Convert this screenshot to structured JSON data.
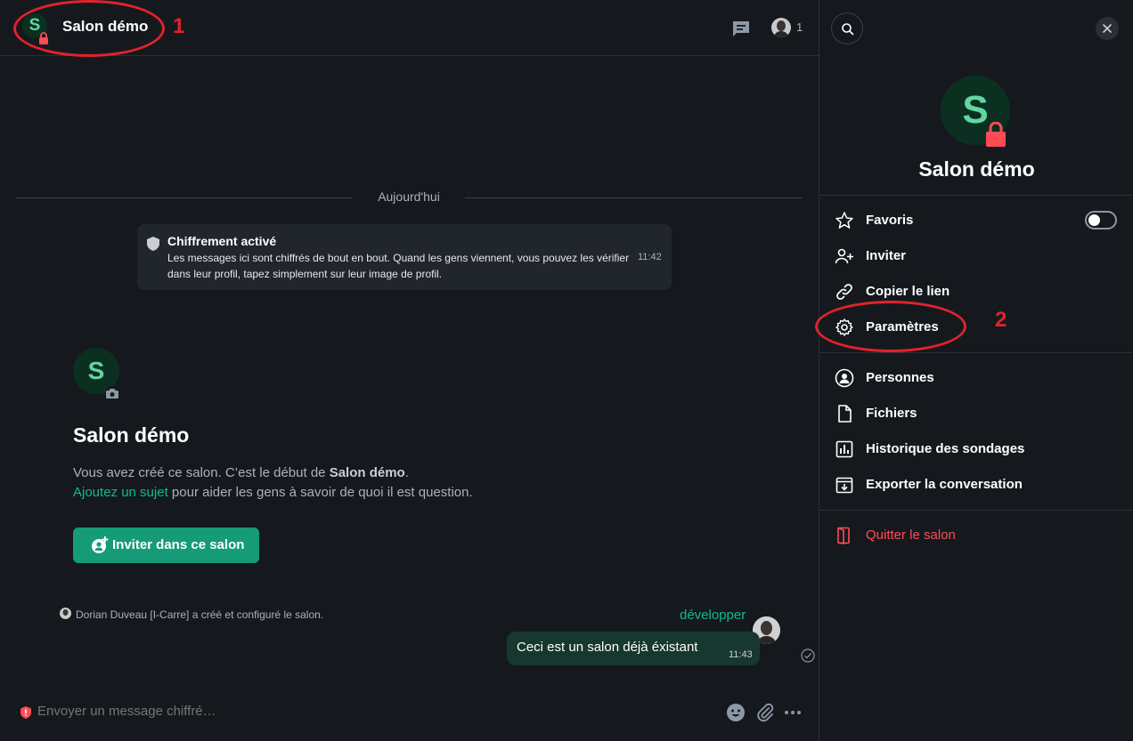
{
  "header": {
    "room_initial": "S",
    "room_title": "Salon démo",
    "annotation_1": "1",
    "member_count": "1"
  },
  "timeline": {
    "day_separator": "Aujourd'hui",
    "encryption": {
      "title": "Chiffrement activé",
      "text": "Les messages ici sont chiffrés de bout en bout. Quand les gens viennent, vous pouvez les vérifier dans leur profil, tapez simplement sur leur image de profil.",
      "time": "11:42"
    },
    "intro": {
      "initial": "S",
      "name": "Salon démo",
      "desc_prefix": "Vous avez créé ce salon. C’est le début de ",
      "desc_room": "Salon démo",
      "desc_suffix": ".",
      "topic_link": "Ajoutez un sujet",
      "topic_rest": " pour aider les gens à savoir de quoi il est question.",
      "invite_label": "Inviter dans ce salon"
    },
    "event_text": "Dorian Duveau [I-Carre] a créé et configuré le salon.",
    "expand_label": "développer",
    "message": {
      "text": "Ceci est un salon déjà éxistant",
      "time": "11:43"
    }
  },
  "composer": {
    "placeholder": "Envoyer un message chiffré…"
  },
  "side_panel": {
    "initial": "S",
    "title": "Salon démo",
    "annotation_2": "2",
    "favorite_on": false,
    "items": [
      {
        "label": "Favoris",
        "icon": "star-icon"
      },
      {
        "label": "Inviter",
        "icon": "add-person-icon"
      },
      {
        "label": "Copier le lien",
        "icon": "link-icon"
      },
      {
        "label": "Paramètres",
        "icon": "gear-icon"
      },
      {
        "label": "Personnes",
        "icon": "person-icon"
      },
      {
        "label": "Fichiers",
        "icon": "file-icon"
      },
      {
        "label": "Historique des sondages",
        "icon": "poll-icon"
      },
      {
        "label": "Exporter la conversation",
        "icon": "export-icon"
      },
      {
        "label": "Quitter le salon",
        "icon": "leave-icon"
      }
    ]
  },
  "colors": {
    "background": "#15191e",
    "accent": "#0dbd8b",
    "danger": "#ff4b55",
    "annotation": "#e2222c"
  }
}
